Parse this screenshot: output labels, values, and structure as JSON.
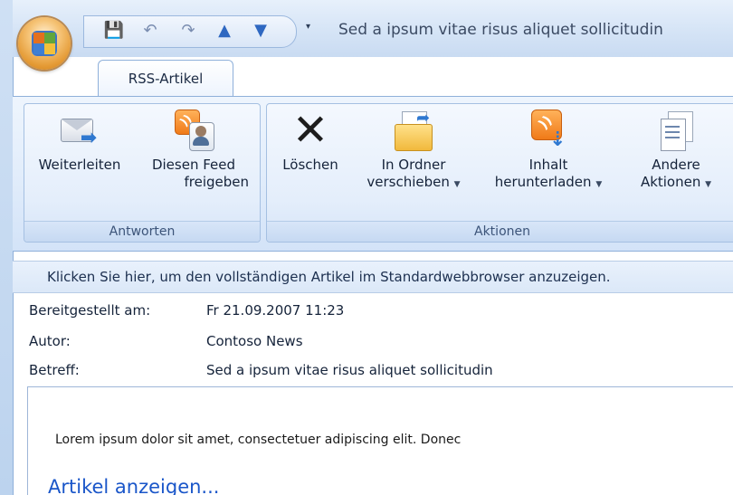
{
  "window": {
    "title": "Sed a ipsum vitae risus aliquet sollicitudin"
  },
  "quick_access": {
    "buttons": [
      "save-icon",
      "undo-icon",
      "redo-icon",
      "up-arrow-icon",
      "down-arrow-icon",
      "customize-dropdown-icon"
    ]
  },
  "tabs": [
    {
      "label": "RSS-Artikel"
    }
  ],
  "ribbon": {
    "groups": [
      {
        "label": "Antworten",
        "buttons": [
          {
            "label": "Weiterleiten",
            "icon": "forward-icon"
          },
          {
            "label_line1": "Diesen Feed",
            "label_line2": "freigeben",
            "icon": "share-feed-icon"
          }
        ]
      },
      {
        "label": "Aktionen",
        "buttons": [
          {
            "label": "Löschen",
            "icon": "delete-icon"
          },
          {
            "label_line1": "In Ordner",
            "label_line2": "verschieben",
            "icon": "move-to-folder-icon"
          },
          {
            "label_line1": "Inhalt",
            "label_line2": "herunterladen",
            "icon": "download-content-icon"
          },
          {
            "label_line1": "Andere",
            "label_line2": "Aktionen",
            "icon": "other-actions-icon"
          }
        ]
      }
    ]
  },
  "infobar": {
    "text": "Klicken Sie hier, um den vollständigen Artikel im Standardwebbrowser anzuzeigen."
  },
  "header": {
    "posted_label": "Bereitgestellt am:",
    "posted_value": "Fr 21.09.2007 11:23",
    "author_label": "Autor:",
    "author_value": "Contoso News",
    "subject_label": "Betreff:",
    "subject_value": "Sed a ipsum vitae risus aliquet sollicitudin"
  },
  "body": {
    "text": "Lorem ipsum dolor sit amet, consectetuer adipiscing elit. Donec",
    "link": "Artikel anzeigen..."
  }
}
